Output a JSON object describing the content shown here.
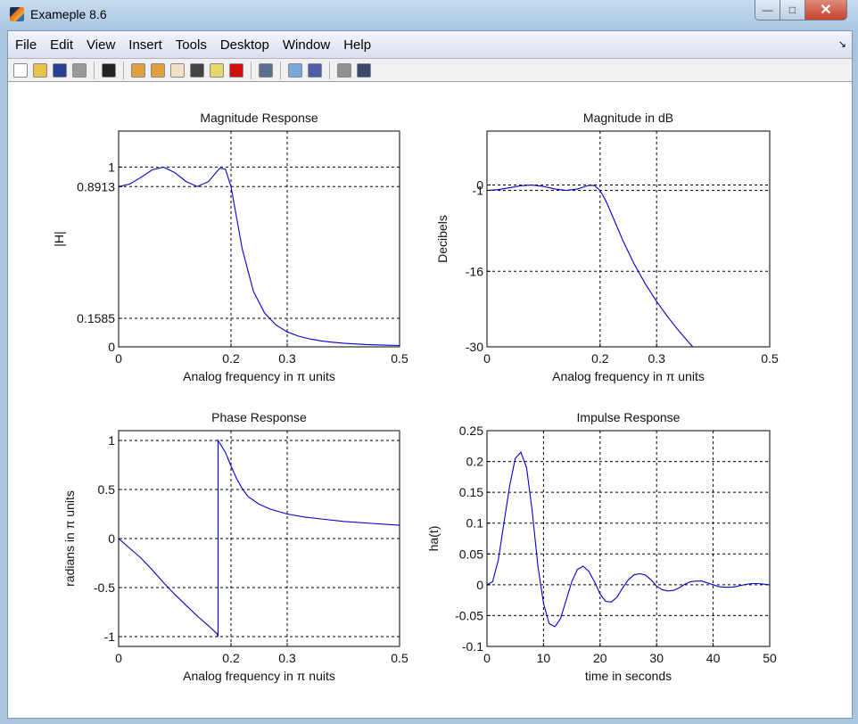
{
  "window": {
    "title": "Exameple 8.6",
    "minimize": "—",
    "maximize": "□",
    "close": "✕"
  },
  "menu": [
    "File",
    "Edit",
    "View",
    "Insert",
    "Tools",
    "Desktop",
    "Window",
    "Help"
  ],
  "menu_arrow": "↘",
  "toolbar": [
    {
      "icon": "new-figure-icon",
      "color": "#ffffff"
    },
    {
      "icon": "open-file-icon",
      "color": "#e8c34a"
    },
    {
      "icon": "save-icon",
      "color": "#2a3f8f"
    },
    {
      "icon": "print-icon",
      "color": "#9a9a9a"
    },
    {
      "sep": true
    },
    {
      "icon": "edit-plot-arrow-icon",
      "color": "#222222"
    },
    {
      "sep": true
    },
    {
      "icon": "zoom-in-icon",
      "color": "#e0a040"
    },
    {
      "icon": "zoom-out-icon",
      "color": "#e0a040"
    },
    {
      "icon": "pan-hand-icon",
      "color": "#f2e0c8"
    },
    {
      "icon": "rotate-3d-icon",
      "color": "#444444"
    },
    {
      "icon": "data-cursor-icon",
      "color": "#e6d86a"
    },
    {
      "icon": "brush-icon",
      "color": "#d01010"
    },
    {
      "sep": true
    },
    {
      "icon": "link-plot-icon",
      "color": "#5a7090"
    },
    {
      "sep": true
    },
    {
      "icon": "colorbar-icon",
      "color": "#7aa6d8"
    },
    {
      "icon": "legend-icon",
      "color": "#5060a8"
    },
    {
      "sep": true
    },
    {
      "icon": "hide-plot-tools-icon",
      "color": "#909090"
    },
    {
      "icon": "show-plot-tools-icon",
      "color": "#3a4a6a"
    }
  ],
  "chart_data": [
    {
      "type": "line",
      "title": "Magnitude Response",
      "xlabel": "Analog frequency in π units",
      "ylabel": "|H|",
      "xlim": [
        0,
        0.5
      ],
      "ylim": [
        0,
        1.2
      ],
      "grid": true,
      "line_color": "#0000cc",
      "xticks": [
        0,
        0.2,
        0.3,
        0.5
      ],
      "xticklabels": [
        "0",
        "0.2",
        "0.3",
        "0.5"
      ],
      "yticks": [
        0,
        0.1585,
        0.8913,
        1
      ],
      "yticklabels": [
        "0",
        "0.1585",
        "0.8913",
        "1"
      ],
      "x": [
        0,
        0.02,
        0.04,
        0.06,
        0.08,
        0.1,
        0.12,
        0.14,
        0.16,
        0.18,
        0.19,
        0.2,
        0.21,
        0.22,
        0.24,
        0.26,
        0.28,
        0.3,
        0.32,
        0.34,
        0.36,
        0.38,
        0.4,
        0.42,
        0.44,
        0.46,
        0.48,
        0.5
      ],
      "y": [
        0.8913,
        0.9055,
        0.9431,
        0.985,
        0.9993,
        0.9691,
        0.9191,
        0.8914,
        0.9191,
        0.9931,
        0.9889,
        0.8913,
        0.7182,
        0.5438,
        0.3081,
        0.1869,
        0.1215,
        0.0833,
        0.0596,
        0.044,
        0.0333,
        0.0257,
        0.0203,
        0.0162,
        0.0131,
        0.0108,
        0.0089,
        0.0075
      ]
    },
    {
      "type": "line",
      "title": "Magnitude in dB",
      "xlabel": "Analog frequency in π units",
      "ylabel": "Decibels",
      "xlim": [
        0,
        0.5
      ],
      "ylim": [
        -30,
        10
      ],
      "grid": true,
      "line_color": "#0000cc",
      "xticks": [
        0,
        0.2,
        0.3,
        0.5
      ],
      "xticklabels": [
        "0",
        "0.2",
        "0.3",
        "0.5"
      ],
      "yticks": [
        -30,
        -16,
        -1,
        0
      ],
      "yticklabels": [
        "-30",
        "-16",
        "-1",
        "0"
      ],
      "x": [
        0,
        0.02,
        0.04,
        0.06,
        0.08,
        0.1,
        0.12,
        0.14,
        0.16,
        0.18,
        0.19,
        0.2,
        0.21,
        0.22,
        0.24,
        0.26,
        0.28,
        0.3,
        0.32,
        0.34,
        0.36,
        0.38
      ],
      "y": [
        -1.0,
        -0.86,
        -0.51,
        -0.13,
        -0.01,
        -0.27,
        -0.73,
        -1.0,
        -0.73,
        -0.06,
        -0.1,
        -1.0,
        -2.88,
        -5.29,
        -10.23,
        -14.57,
        -18.31,
        -21.59,
        -24.5,
        -27.13,
        -29.55,
        -31.8
      ]
    },
    {
      "type": "line",
      "title": "Phase Response",
      "xlabel": "Analog frequency in π nuits",
      "ylabel": "radians in π units",
      "xlim": [
        0,
        0.5
      ],
      "ylim": [
        -1.1,
        1.1
      ],
      "grid": true,
      "line_color": "#0000cc",
      "xticks": [
        0,
        0.2,
        0.3,
        0.5
      ],
      "xticklabels": [
        "0",
        "0.2",
        "0.3",
        "0.5"
      ],
      "yticks": [
        -1,
        -0.5,
        0,
        0.5,
        1
      ],
      "yticklabels": [
        "-1",
        "-0.5",
        "0",
        "0.5",
        "1"
      ],
      "x": [
        0,
        0.02,
        0.04,
        0.06,
        0.08,
        0.1,
        0.12,
        0.14,
        0.16,
        0.175,
        0.177,
        0.177,
        0.19,
        0.2,
        0.21,
        0.22,
        0.23,
        0.25,
        0.27,
        0.3,
        0.33,
        0.36,
        0.4,
        0.45,
        0.5
      ],
      "y": [
        0,
        -0.1,
        -0.2,
        -0.32,
        -0.45,
        -0.57,
        -0.68,
        -0.79,
        -0.89,
        -0.97,
        -1.0,
        1.0,
        0.88,
        0.74,
        0.61,
        0.51,
        0.43,
        0.35,
        0.3,
        0.25,
        0.22,
        0.2,
        0.175,
        0.155,
        0.135
      ]
    },
    {
      "type": "line",
      "title": "Impulse Response",
      "xlabel": "time in seconds",
      "ylabel": "ha(t)",
      "xlim": [
        0,
        50
      ],
      "ylim": [
        -0.1,
        0.25
      ],
      "grid": true,
      "line_color": "#0000cc",
      "xticks": [
        0,
        10,
        20,
        30,
        40,
        50
      ],
      "xticklabels": [
        "0",
        "10",
        "20",
        "30",
        "40",
        "50"
      ],
      "yticks": [
        -0.1,
        -0.05,
        0,
        0.05,
        0.1,
        0.15,
        0.2,
        0.25
      ],
      "yticklabels": [
        "-0.1",
        "-0.05",
        "0",
        "0.05",
        "0.1",
        "0.15",
        "0.2",
        "0.25"
      ],
      "x": [
        0,
        1,
        2,
        3,
        4,
        5,
        6,
        7,
        8,
        9,
        10,
        11,
        12,
        13,
        14,
        15,
        16,
        17,
        18,
        19,
        20,
        21,
        22,
        23,
        24,
        25,
        26,
        27,
        28,
        29,
        30,
        31,
        32,
        33,
        34,
        35,
        36,
        37,
        38,
        39,
        40,
        41,
        42,
        43,
        44,
        45,
        46,
        47,
        48,
        49,
        50
      ],
      "y": [
        0,
        0.005,
        0.04,
        0.1,
        0.16,
        0.205,
        0.215,
        0.19,
        0.12,
        0.03,
        -0.03,
        -0.063,
        -0.068,
        -0.055,
        -0.025,
        0.005,
        0.025,
        0.03,
        0.022,
        0.005,
        -0.015,
        -0.027,
        -0.028,
        -0.02,
        -0.005,
        0.008,
        0.016,
        0.018,
        0.016,
        0.008,
        -0.002,
        -0.008,
        -0.01,
        -0.009,
        -0.005,
        0.001,
        0.005,
        0.006,
        0.006,
        0.003,
        0,
        -0.003,
        -0.004,
        -0.004,
        -0.003,
        -0.001,
        0.001,
        0.002,
        0.002,
        0.001,
        0
      ]
    }
  ]
}
